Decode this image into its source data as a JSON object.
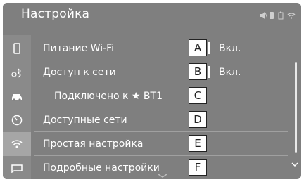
{
  "header": {
    "title": "Настройка"
  },
  "rows": [
    {
      "label": "Питание Wi-Fi",
      "value": "Вкл.",
      "marker": "A"
    },
    {
      "label": "Доступ к сети",
      "value": "Вкл.",
      "marker": "B"
    },
    {
      "label": "Подключено к ★ BT1",
      "value": "",
      "marker": "C"
    },
    {
      "label": "Доступные сети",
      "value": "",
      "marker": "D"
    },
    {
      "label": "Простая настройка",
      "value": "",
      "marker": "E"
    },
    {
      "label": "Подробные настройки",
      "value": "",
      "marker": "F"
    }
  ],
  "sidebar": [
    "phone-icon",
    "bluetooth-settings-icon",
    "car-icon",
    "sound-icon",
    "wifi-icon",
    "message-icon"
  ],
  "colors": {
    "screen_bg": "#7f7f7f",
    "selected": "#a6a6a6",
    "text": "#ffffff"
  }
}
